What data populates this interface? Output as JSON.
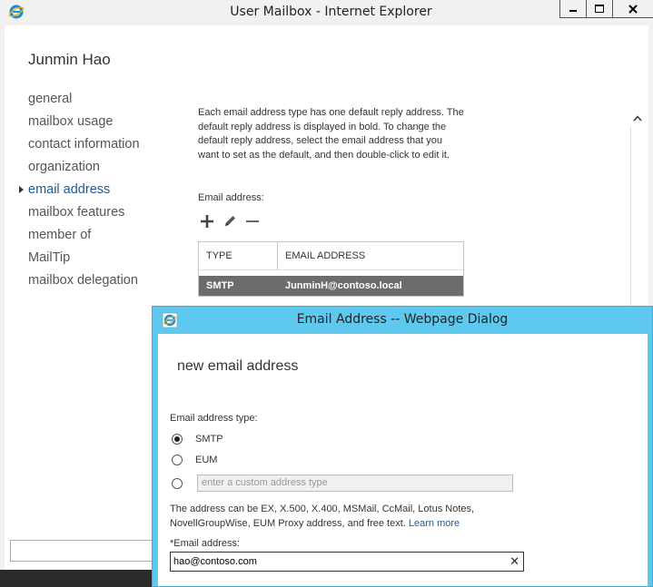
{
  "main_window": {
    "title": "User Mailbox - Internet Explorer"
  },
  "mailbox": {
    "user_name": "Junmin Hao",
    "nav": [
      {
        "label": "general"
      },
      {
        "label": "mailbox usage"
      },
      {
        "label": "contact information"
      },
      {
        "label": "organization"
      },
      {
        "label": "email address",
        "active": true
      },
      {
        "label": "mailbox features"
      },
      {
        "label": "member of"
      },
      {
        "label": "MailTip"
      },
      {
        "label": "mailbox delegation"
      }
    ],
    "description": "Each email address type has one default reply address. The default reply address is displayed in bold. To change the default reply address, select the email address that you want to set as the default, and then double-click to edit it.",
    "email_label": "Email address:",
    "table": {
      "headers": [
        "TYPE",
        "EMAIL ADDRESS"
      ],
      "rows": [
        {
          "type": "SMTP",
          "address": "JunminH@contoso.local"
        }
      ]
    }
  },
  "dialog": {
    "title": "Email Address -- Webpage Dialog",
    "heading": "new email address",
    "type_label": "Email address type:",
    "options": [
      {
        "label": "SMTP",
        "selected": true
      },
      {
        "label": "EUM",
        "selected": false
      }
    ],
    "custom_placeholder": "enter a custom address type",
    "hint_text": "The address can be EX, X.500, X.400, MSMail, CcMail, Lotus Notes, NovellGroupWise, EUM Proxy address, and free text.",
    "learn_more": "Learn more",
    "address_label": "*Email address:",
    "address_value": "hao@contoso.com",
    "clear_glyph": "✕"
  },
  "icons": {
    "add": "plus-icon",
    "edit": "pencil-icon",
    "remove": "minus-icon",
    "app": "internet-explorer-icon"
  },
  "colors": {
    "dialog_frame": "#5ec8ee",
    "selected_row": "#6c6c6c",
    "link": "#1e5a96"
  }
}
